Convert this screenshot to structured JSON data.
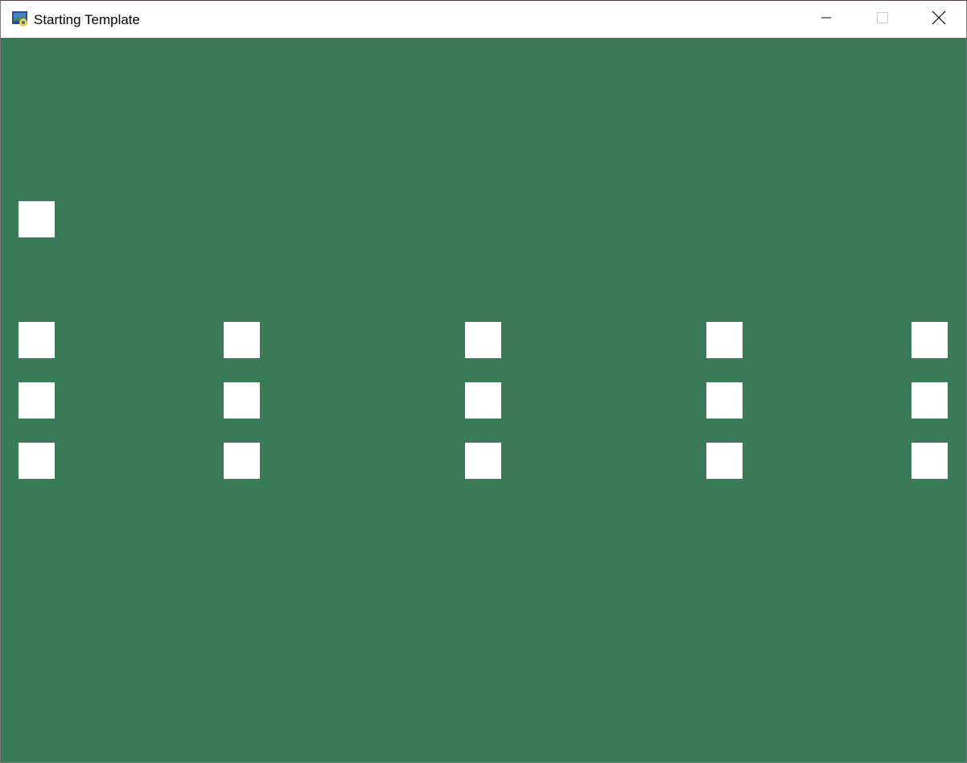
{
  "window": {
    "title": "Starting Template",
    "icon": "python-app-icon",
    "controls": {
      "minimize_icon": "minimize-icon",
      "maximize_icon": "maximize-icon",
      "close_icon": "close-icon"
    }
  },
  "colors": {
    "background": "#3b7a57",
    "tile": "#ffffff",
    "titlebar": "#ffffff"
  },
  "tiles": {
    "count": 16
  }
}
